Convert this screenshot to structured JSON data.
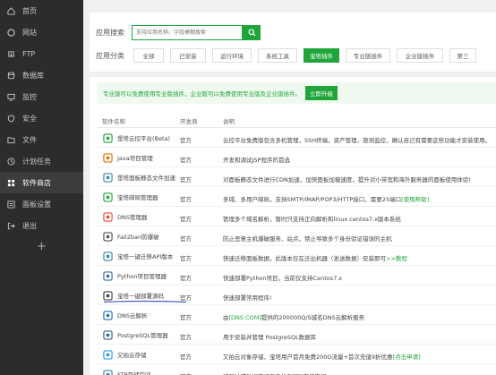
{
  "sidebar": {
    "items": [
      {
        "label": "首页",
        "icon": "home-icon"
      },
      {
        "label": "网站",
        "icon": "globe-icon"
      },
      {
        "label": "FTP",
        "icon": "ftp-icon"
      },
      {
        "label": "数据库",
        "icon": "database-icon"
      },
      {
        "label": "监控",
        "icon": "monitor-icon"
      },
      {
        "label": "安全",
        "icon": "shield-icon"
      },
      {
        "label": "文件",
        "icon": "folder-icon"
      },
      {
        "label": "计划任务",
        "icon": "clock-icon"
      },
      {
        "label": "软件商店",
        "icon": "grid-icon"
      },
      {
        "label": "面板设置",
        "icon": "settings-icon"
      },
      {
        "label": "退出",
        "icon": "logout-icon"
      }
    ],
    "active_index": 8,
    "add_label": "+"
  },
  "search": {
    "label": "应用搜索",
    "placeholder": "支持应用名称、字段模糊搜索"
  },
  "categories": {
    "label": "应用分类",
    "items": [
      "全部",
      "已安装",
      "运行环境",
      "系统工具",
      "宝塔插件",
      "专业版插件",
      "企业版插件",
      "第三"
    ],
    "active_index": 4
  },
  "notice": {
    "text": "专业版可以免费使用专业版插件，企业版可以免费使用专业版及企业版插件。",
    "button": "立即升级"
  },
  "table": {
    "headers": [
      "软件名称",
      "开发商",
      "说明"
    ],
    "rows": [
      {
        "name": "堡塔云控平台(Beta)",
        "dev": "官方",
        "desc": "云控平台免费版包含多机管理，SSH终端，资产管理，旅测监控，确认自己有需要这些功能才安装使用。",
        "icon": "cloud-icon",
        "color": "#20a53a"
      },
      {
        "name": "Java项目管理",
        "dev": "官方",
        "desc": "开发和调试JSP程序的首选",
        "icon": "java-icon",
        "color": "#e76f00"
      },
      {
        "name": "堡塔面板静态文件加速",
        "dev": "官方",
        "desc": "对面板静态文件进行CDN加速，加快面板加载速度，提升对小带宽和海外服务器的面板使用体验!",
        "icon": "cdn-icon",
        "color": "#3a87ad"
      },
      {
        "name": "宝塔邮局管理器",
        "dev": "官方",
        "desc": "多域、多用户邮局，支持SMTP/IMAP/POP3/HTTP接口，需要25端口",
        "link": "[使用帮助]",
        "icon": "mail-icon",
        "color": "#20a53a"
      },
      {
        "name": "DNS管理器",
        "dev": "官方",
        "desc": "管理多个域名解析，暂时只支持正向解析和linux centos7.x版本系统",
        "icon": "dns-icon",
        "color": "#e74c3c"
      },
      {
        "name": "Fail2ban防爆破",
        "dev": "官方",
        "desc": "防止恶意主机爆破服务、站点，禁止导致多个身份验证错误的主机",
        "icon": "fail2ban-icon",
        "color": "#555555"
      },
      {
        "name": "宝塔一键迁移API版本",
        "dev": "官方",
        "desc": "快速迁移面板数据，此版本仅在迁出机器（发送数据）安装即可",
        "link": ">>教程",
        "icon": "migrate-icon",
        "color": "#3a87ad"
      },
      {
        "name": "Python项目管理器",
        "dev": "官方",
        "desc": "快速部署Python项目，当前仅支持Centos7.x",
        "icon": "python-icon",
        "color": "#3572a5"
      },
      {
        "name": "宝塔一键部署源码",
        "dev": "官方",
        "desc": "快速部署常用程序!",
        "icon": "code-icon",
        "color": "#444444"
      },
      {
        "name": "DNS云解析",
        "dev": "官方",
        "desc_pre": "由",
        "link": "[DNS.COM]",
        "desc": "提供的200000Q/S城名DNS云解析服务",
        "icon": "dns-cloud-icon",
        "color": "#2b6cb0"
      },
      {
        "name": "PostgreSQL管理器",
        "dev": "官方",
        "desc": "用于安装并管理 PostgreSQL数据库",
        "icon": "postgres-icon",
        "color": "#336791"
      },
      {
        "name": "又拍云存储",
        "dev": "官方",
        "desc": "又拍云对象存储，宝塔用户首月免费200G流量+首次充值9折优惠",
        "link": "[点击申请]",
        "icon": "upyun-icon",
        "color": "#2b9fe8"
      },
      {
        "name": "FTP存储空间",
        "dev": "官方",
        "desc": "将网站或数据库打包备份到FTP存储空间",
        "icon": "ftp-storage-icon",
        "color": "#3a87ad"
      }
    ]
  }
}
